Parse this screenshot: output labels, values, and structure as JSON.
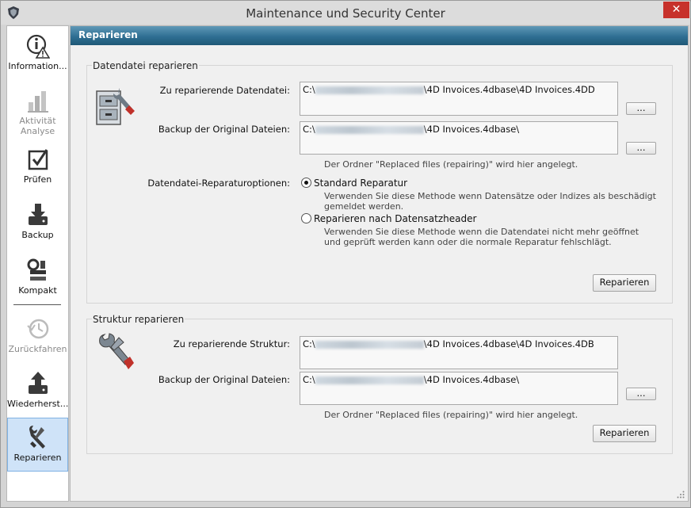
{
  "window": {
    "title": "Maintenance und Security Center",
    "close_glyph": "✕"
  },
  "sidebar": {
    "items": [
      {
        "label": "Information...",
        "icon": "information-warning-icon",
        "enabled": true
      },
      {
        "label": "Aktivität Analyse",
        "icon": "bar-chart-icon",
        "enabled": false
      },
      {
        "label": "Prüfen",
        "icon": "checkbox-icon",
        "enabled": true
      },
      {
        "label": "Backup",
        "icon": "backup-icon",
        "enabled": true
      },
      {
        "label": "Kompakt",
        "icon": "compact-icon",
        "enabled": true
      },
      {
        "label": "Zurückfahren",
        "icon": "rollback-clock-icon",
        "enabled": false
      },
      {
        "label": "Wiederherst...",
        "icon": "restore-icon",
        "enabled": true
      },
      {
        "label": "Reparieren",
        "icon": "repair-tools-icon",
        "enabled": true,
        "selected": true
      }
    ]
  },
  "header": {
    "title": "Reparieren"
  },
  "data_file": {
    "group_title": "Datendatei reparieren",
    "file_label": "Zu reparierende Datendatei:",
    "file_path_prefix": "C:\\",
    "file_path_suffix": "\\4D Invoices.4dbase\\4D Invoices.4DD",
    "backup_label": "Backup der Original Dateien:",
    "backup_path_prefix": "C:\\",
    "backup_path_suffix": "\\4D Invoices.4dbase\\",
    "browse_label": "...",
    "backup_hint": "Der Ordner \"Replaced files (repairing)\" wird hier angelegt.",
    "options_label": "Datendatei-Reparaturoptionen:",
    "option_standard": "Standard Reparatur",
    "option_standard_desc": "Verwenden Sie diese Methode wenn Datensätze oder Indizes als beschädigt gemeldet werden.",
    "option_header": "Reparieren nach Datensatzheader",
    "option_header_desc": "Verwenden Sie diese Methode wenn die Datendatei nicht mehr geöffnet und geprüft werden kann oder die normale Reparatur fehlschlägt.",
    "selected_option": "standard",
    "repair_button": "Reparieren"
  },
  "structure": {
    "group_title": "Struktur reparieren",
    "file_label": "Zu reparierende Struktur:",
    "file_path_prefix": "C:\\",
    "file_path_suffix": "\\4D Invoices.4dbase\\4D Invoices.4DB",
    "backup_label": "Backup der Original Dateien:",
    "backup_path_prefix": "C:\\",
    "backup_path_suffix": "\\4D Invoices.4dbase\\",
    "browse_label": "...",
    "backup_hint": "Der Ordner \"Replaced files (repairing)\" wird hier angelegt.",
    "repair_button": "Reparieren"
  }
}
